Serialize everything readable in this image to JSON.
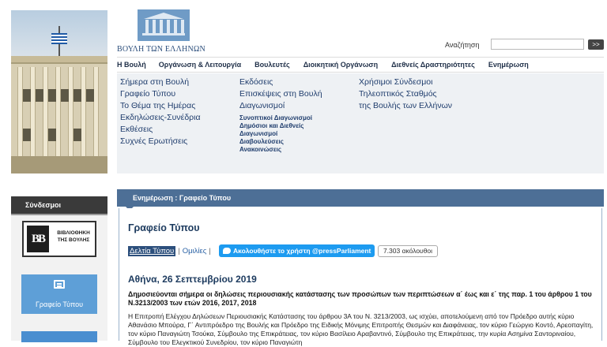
{
  "logo": {
    "text": "ΒΟΥΛΗ ΤΩΝ ΕΛΛΗΝΩΝ"
  },
  "search": {
    "label": "Αναζήτηση",
    "placeholder": "",
    "button": ">>"
  },
  "topnav": [
    "Η Βουλή",
    "Οργάνωση & Λειτουργία",
    "Βουλευτές",
    "Διοικητική Οργάνωση",
    "Διεθνείς Δραστηριότητες",
    "Ενημέρωση"
  ],
  "menu": {
    "col1": [
      "Σήμερα στη Βουλή",
      "Γραφείο Τύπου",
      "Το Θέμα της Ημέρας",
      "Εκδηλώσεις-Συνέδρια",
      "Εκθέσεις",
      "Συχνές Ερωτήσεις"
    ],
    "col2_big": [
      "Εκδόσεις",
      "Επισκέψεις στη Βουλή",
      "Διαγωνισμοί"
    ],
    "col2_small": [
      "Συνοπτικοί Διαγωνισμοί",
      "Δημόσιοι και Διεθνείς",
      "Διαγωνισμοί",
      "Διαβουλεύσεις",
      "Ανακοινώσεις"
    ],
    "col3": [
      "Χρήσιμοι Σύνδεσμοι",
      "Τηλεοπτικός Σταθμός",
      "της Βουλής των Ελλήνων"
    ]
  },
  "sidebar": {
    "title": "Σύνδεσμοι",
    "library": {
      "mark": "BB",
      "line1": "ΒΙΒΛΙΟΘΗΚΗ",
      "line2": "ΤΗΣ ΒΟΥΛΗΣ"
    },
    "press": "Γραφείο Τύπου"
  },
  "breadcrumb": "Ενημέρωση : Γραφείο Τύπου",
  "page_title": "Γραφείο Τύπου",
  "tabs": {
    "active": "Δελτία Τύπου",
    "sep": "|",
    "other": "Ομιλίες",
    "other_sep": "|"
  },
  "twitter": {
    "follow": "Ακολουθήστε το χρήστη @pressParliament",
    "followers": "7.303 ακόλουθοι"
  },
  "article": {
    "date": "Αθήνα, 26 Σεπτεμβρίου 2019",
    "headline": "Δημοσιεύονται σήμερα οι δηλώσεις περιουσιακής κατάστασης των προσώπων των περιπτώσεων α΄ έως και ε΄ της παρ. 1 του άρθρου 1 του Ν.3213/2003 των ετών 2016, 2017, 2018",
    "body": "Η Επιτροπή Ελέγχου Δηλώσεων Περιουσιακής Κατάστασης του άρθρου 3Α του Ν. 3213/2003, ως ισχύει, αποτελούμενη από τον Πρόεδρο αυτής κύριο Αθανάσιο Μπούρα, Γ΄ Αντιπρόεδρο της Βουλής και Πρόεδρο της Ειδικής Μόνιμης Επιτροπής Θεσμών και Διαφάνειας, τον κύριο Γεώργιο Κοντό, Αρεοπαγίτη, τον κύριο Παναγιώτη Τσούκα, Σύμβουλο της Επικράτειας, τον κύριο Βασίλειο Αραβαντινό, Σύμβουλο της Επικράτειας, την κυρία Ασημίνα Σαντοριναίου, Σύμβουλο του Ελεγκτικού Συνεδρίου, τον κύριο Παναγιώτη"
  }
}
